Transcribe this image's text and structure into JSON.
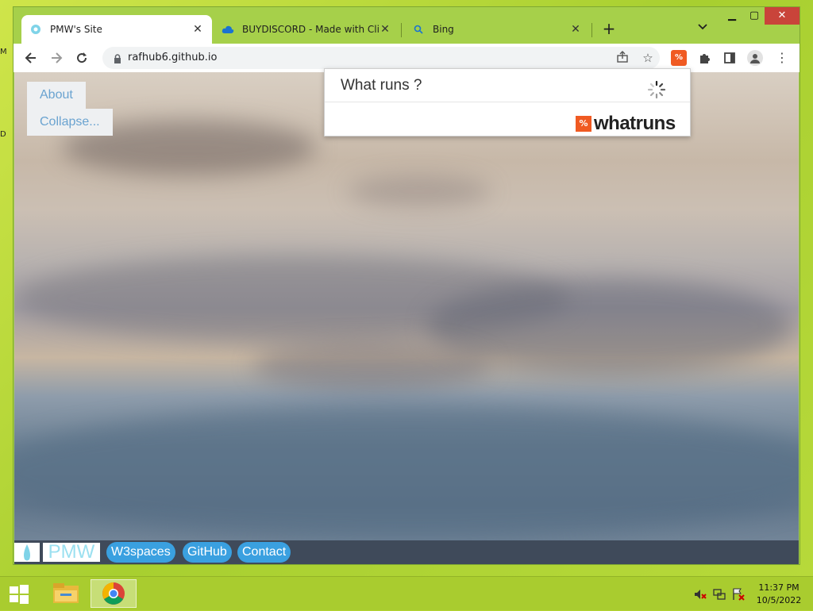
{
  "desktop": {
    "side_letters": [
      "M",
      "D"
    ]
  },
  "browser": {
    "tabs": [
      {
        "title": "PMW's Site",
        "favicon": "pmw-favicon",
        "active": true
      },
      {
        "title": "BUYDISCORD - Made with Clipch",
        "favicon": "cloud-favicon",
        "active": false
      },
      {
        "title": "Bing",
        "favicon": "search-favicon",
        "active": false
      }
    ],
    "new_tab": "+",
    "url": "rafhub6.github.io"
  },
  "page": {
    "menu": {
      "about": "About",
      "collapse": "Collapse..."
    },
    "footer": {
      "brand": "PMW",
      "links": [
        "W3spaces",
        "GitHub",
        "Contact"
      ]
    }
  },
  "popup": {
    "title": "What runs ?",
    "brand": "whatruns",
    "brand_mark": "%"
  },
  "taskbar": {
    "time": "11:37 PM",
    "date": "10/5/2022"
  },
  "colors": {
    "link_blue": "#3aa0e0",
    "whatruns_orange": "#f05a22",
    "taskbar_green": "#a9cc2f",
    "close_red": "#c9443a"
  }
}
